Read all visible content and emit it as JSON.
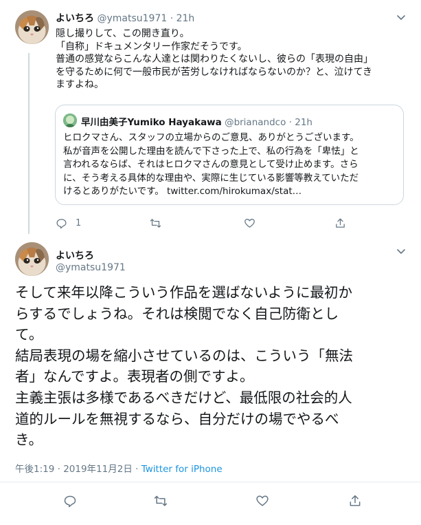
{
  "tweet1": {
    "display_name": "よいちろ",
    "handle": "@ymatsu1971",
    "separator": "·",
    "time": "21h",
    "text_lines": [
      "隠し撮りして、この開き直り。",
      "「自称」ドキュメンタリー作家だそうです。",
      "普通の感覚ならこんな人達とは関わりたくないし、彼らの「表現の自由」",
      "を守るために何で一般市民が苦労しなければならないのか？と、泣けてき",
      "ますよね。"
    ],
    "reply_count": "1"
  },
  "quote": {
    "display_name": "早川由美子Yumiko Hayakawa",
    "handle": "@brianandco",
    "separator": "·",
    "time": "21h",
    "text_lines": [
      "ヒロクマさん、スタッフの立場からのご意見、ありがとうございます。",
      "私が音声を公開した理由を読んで下さった上で、私の行為を「卑怯」と",
      "言われるならば、それはヒロクマさんの意見として受け止めます。さら",
      "に、そう考える具体的な理由や、実際に生じている影響等教えていただ"
    ],
    "last_line_text": "けるとありがたいです。",
    "link": "twitter.com/hirokumax/stat…"
  },
  "tweet2": {
    "display_name": "よいちろ",
    "handle": "@ymatsu1971",
    "text_lines": [
      "そして来年以降こういう作品を選ばないように最初か",
      "らするでしょうね。それは検閲でなく自己防衛とし",
      "て。",
      "結局表現の場を縮小させているのは、こういう「無法",
      "者」なんですよ。表現者の側ですよ。",
      "主義主張は多様であるべきだけど、最低限の社会的人",
      "道的ルールを無視するなら、自分だけの場でやるべ",
      "き。"
    ],
    "timestamp": "午後1:19 · 2019年11月2日 ·",
    "source": "Twitter for iPhone"
  },
  "icons": {
    "reply": "reply-icon",
    "retweet": "retweet-icon",
    "like": "heart-icon",
    "share": "share-icon",
    "more": "chevron-down-icon"
  },
  "colors": {
    "text": "#14171a",
    "muted": "#657786",
    "link": "#1b95e0",
    "border": "#ccd6dd",
    "thread_line": "#cfd9de"
  }
}
